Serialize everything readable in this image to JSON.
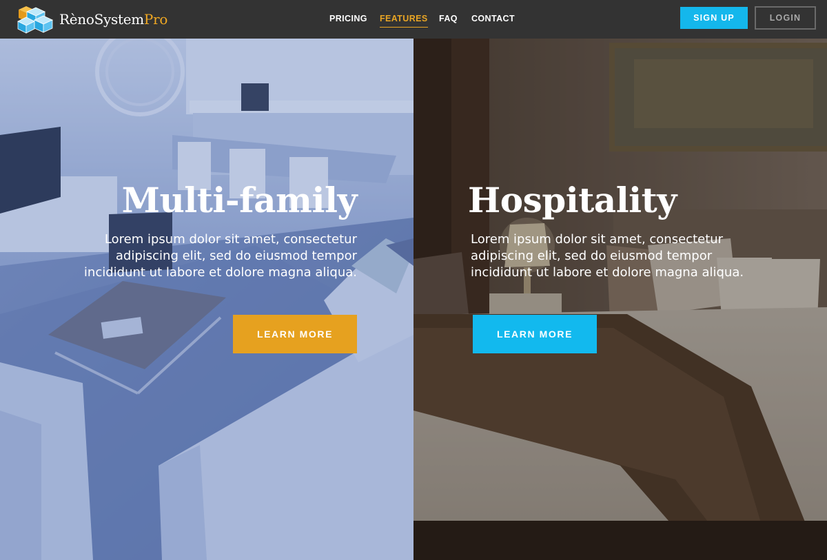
{
  "brand": {
    "name_main": "RènoSystem",
    "name_accent": "Pro",
    "logo_icon": "isometric-cubes-logo",
    "accent_color": "#f0a823"
  },
  "nav": {
    "items": [
      {
        "label": "PRICING",
        "active": false
      },
      {
        "label": "FEATURES",
        "active": true
      },
      {
        "label": "FAQ",
        "active": false
      },
      {
        "label": "CONTACT",
        "active": false
      }
    ],
    "signup_label": "SIGN UP",
    "login_label": "LOGIN",
    "active_color": "#e9a524",
    "signup_color": "#14b7ec"
  },
  "panels": {
    "left": {
      "title": "Multi-family",
      "description": "Lorem ipsum dolor sit amet, consectetur adipiscing elit, sed do eiusmod tempor incididunt ut labore et dolore magna aliqua.",
      "button_label": "LEARN MORE",
      "button_color": "#e6a11f",
      "image": "living-room-photo"
    },
    "right": {
      "title": "Hospitality",
      "description": "Lorem ipsum dolor sit amet, consectetur adipiscing elit, sed do eiusmod tempor incididunt ut labore et dolore magna aliqua.",
      "button_label": "LEARN MORE",
      "button_color": "#12b9ee",
      "image": "hotel-bedroom-photo"
    }
  }
}
